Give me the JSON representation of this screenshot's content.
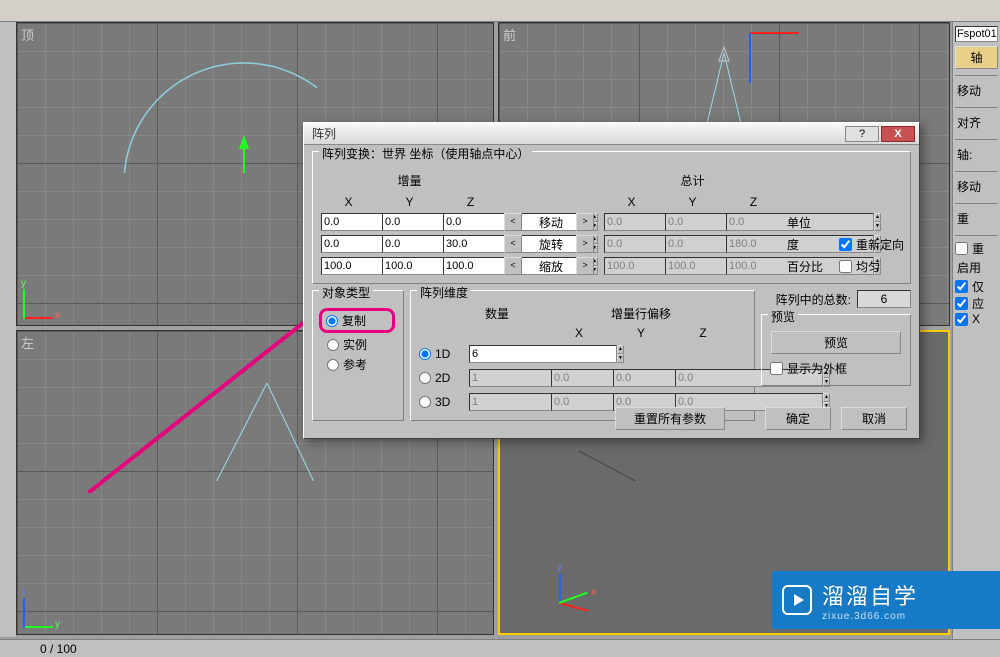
{
  "viewports": {
    "top_label": "顶",
    "front_label": "前",
    "left_label": "左",
    "persp_label": ""
  },
  "dialog": {
    "title": "阵列",
    "help_label": "?",
    "close_label": "X",
    "transform_title": "阵列变换：世界 坐标（使用轴点中心）",
    "inc_label": "增量",
    "tot_label": "总计",
    "x_label": "X",
    "y_label": "Y",
    "z_label": "Z",
    "rows": {
      "move": {
        "ix": "0.0",
        "iy": "0.0",
        "iz": "0.0",
        "op": "移动",
        "tx": "0.0",
        "ty": "0.0",
        "tz": "0.0",
        "unit": "单位"
      },
      "rotate": {
        "ix": "0.0",
        "iy": "0.0",
        "iz": "30.0",
        "op": "旋转",
        "tx": "0.0",
        "ty": "0.0",
        "tz": "180.0",
        "unit": "度"
      },
      "scale": {
        "ix": "100.0",
        "iy": "100.0",
        "iz": "100.0",
        "op": "缩放",
        "tx": "100.0",
        "ty": "100.0",
        "tz": "100.0",
        "unit": "百分比"
      }
    },
    "reorient_label": "重新定向",
    "uniform_label": "均匀",
    "obj_type": {
      "title": "对象类型",
      "copy": "复制",
      "instance": "实例",
      "reference": "参考"
    },
    "dims": {
      "title": "阵列维度",
      "count": "数量",
      "row_offset": "增量行偏移",
      "d1": "1D",
      "d2": "2D",
      "d3": "3D",
      "n1": "6",
      "n2": "1",
      "n3": "1",
      "x2": "0.0",
      "y2": "0.0",
      "z2": "0.0",
      "x3": "0.0",
      "y3": "0.0",
      "z3": "0.0"
    },
    "total_label": "阵列中的总数:",
    "total_value": "6",
    "preview_title": "预览",
    "preview_btn": "预览",
    "display_bb": "显示为外框",
    "reset_btn": "重置所有参数",
    "ok_btn": "确定",
    "cancel_btn": "取消"
  },
  "rightpanel": {
    "name_field": "Fspot01",
    "axis_btn": "轴",
    "move_lbl": "移动",
    "align_lbl": "对齐",
    "axis2_lbl": "轴:",
    "move2_lbl": "移动",
    "reset_lbl": "重",
    "enable_lbl": "启用",
    "chk1": "仅",
    "chk2": "应",
    "chk3": "X"
  },
  "status": {
    "frame": "0 / 100"
  },
  "watermark": {
    "main": "溜溜自学",
    "sub": "zixue.3d66.com"
  }
}
